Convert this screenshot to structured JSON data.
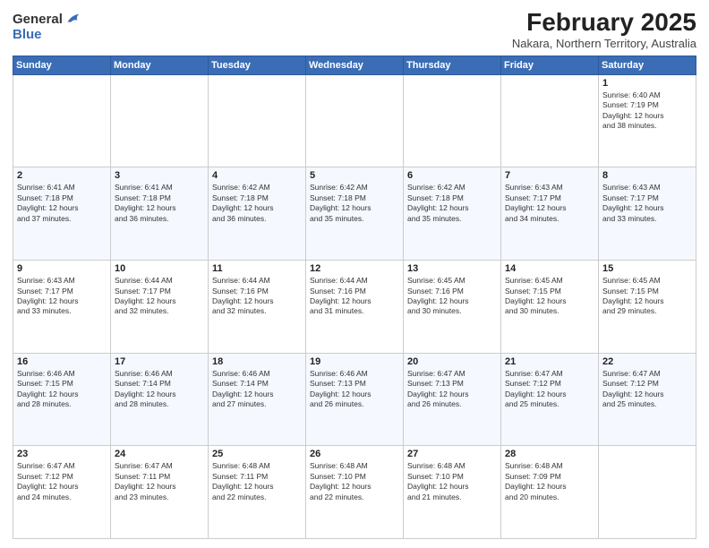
{
  "logo": {
    "general": "General",
    "blue": "Blue"
  },
  "title": "February 2025",
  "subtitle": "Nakara, Northern Territory, Australia",
  "days_of_week": [
    "Sunday",
    "Monday",
    "Tuesday",
    "Wednesday",
    "Thursday",
    "Friday",
    "Saturday"
  ],
  "weeks": [
    [
      {
        "day": "",
        "info": ""
      },
      {
        "day": "",
        "info": ""
      },
      {
        "day": "",
        "info": ""
      },
      {
        "day": "",
        "info": ""
      },
      {
        "day": "",
        "info": ""
      },
      {
        "day": "",
        "info": ""
      },
      {
        "day": "1",
        "info": "Sunrise: 6:40 AM\nSunset: 7:19 PM\nDaylight: 12 hours\nand 38 minutes."
      }
    ],
    [
      {
        "day": "2",
        "info": "Sunrise: 6:41 AM\nSunset: 7:18 PM\nDaylight: 12 hours\nand 37 minutes."
      },
      {
        "day": "3",
        "info": "Sunrise: 6:41 AM\nSunset: 7:18 PM\nDaylight: 12 hours\nand 36 minutes."
      },
      {
        "day": "4",
        "info": "Sunrise: 6:42 AM\nSunset: 7:18 PM\nDaylight: 12 hours\nand 36 minutes."
      },
      {
        "day": "5",
        "info": "Sunrise: 6:42 AM\nSunset: 7:18 PM\nDaylight: 12 hours\nand 35 minutes."
      },
      {
        "day": "6",
        "info": "Sunrise: 6:42 AM\nSunset: 7:18 PM\nDaylight: 12 hours\nand 35 minutes."
      },
      {
        "day": "7",
        "info": "Sunrise: 6:43 AM\nSunset: 7:17 PM\nDaylight: 12 hours\nand 34 minutes."
      },
      {
        "day": "8",
        "info": "Sunrise: 6:43 AM\nSunset: 7:17 PM\nDaylight: 12 hours\nand 33 minutes."
      }
    ],
    [
      {
        "day": "9",
        "info": "Sunrise: 6:43 AM\nSunset: 7:17 PM\nDaylight: 12 hours\nand 33 minutes."
      },
      {
        "day": "10",
        "info": "Sunrise: 6:44 AM\nSunset: 7:17 PM\nDaylight: 12 hours\nand 32 minutes."
      },
      {
        "day": "11",
        "info": "Sunrise: 6:44 AM\nSunset: 7:16 PM\nDaylight: 12 hours\nand 32 minutes."
      },
      {
        "day": "12",
        "info": "Sunrise: 6:44 AM\nSunset: 7:16 PM\nDaylight: 12 hours\nand 31 minutes."
      },
      {
        "day": "13",
        "info": "Sunrise: 6:45 AM\nSunset: 7:16 PM\nDaylight: 12 hours\nand 30 minutes."
      },
      {
        "day": "14",
        "info": "Sunrise: 6:45 AM\nSunset: 7:15 PM\nDaylight: 12 hours\nand 30 minutes."
      },
      {
        "day": "15",
        "info": "Sunrise: 6:45 AM\nSunset: 7:15 PM\nDaylight: 12 hours\nand 29 minutes."
      }
    ],
    [
      {
        "day": "16",
        "info": "Sunrise: 6:46 AM\nSunset: 7:15 PM\nDaylight: 12 hours\nand 28 minutes."
      },
      {
        "day": "17",
        "info": "Sunrise: 6:46 AM\nSunset: 7:14 PM\nDaylight: 12 hours\nand 28 minutes."
      },
      {
        "day": "18",
        "info": "Sunrise: 6:46 AM\nSunset: 7:14 PM\nDaylight: 12 hours\nand 27 minutes."
      },
      {
        "day": "19",
        "info": "Sunrise: 6:46 AM\nSunset: 7:13 PM\nDaylight: 12 hours\nand 26 minutes."
      },
      {
        "day": "20",
        "info": "Sunrise: 6:47 AM\nSunset: 7:13 PM\nDaylight: 12 hours\nand 26 minutes."
      },
      {
        "day": "21",
        "info": "Sunrise: 6:47 AM\nSunset: 7:12 PM\nDaylight: 12 hours\nand 25 minutes."
      },
      {
        "day": "22",
        "info": "Sunrise: 6:47 AM\nSunset: 7:12 PM\nDaylight: 12 hours\nand 25 minutes."
      }
    ],
    [
      {
        "day": "23",
        "info": "Sunrise: 6:47 AM\nSunset: 7:12 PM\nDaylight: 12 hours\nand 24 minutes."
      },
      {
        "day": "24",
        "info": "Sunrise: 6:47 AM\nSunset: 7:11 PM\nDaylight: 12 hours\nand 23 minutes."
      },
      {
        "day": "25",
        "info": "Sunrise: 6:48 AM\nSunset: 7:11 PM\nDaylight: 12 hours\nand 22 minutes."
      },
      {
        "day": "26",
        "info": "Sunrise: 6:48 AM\nSunset: 7:10 PM\nDaylight: 12 hours\nand 22 minutes."
      },
      {
        "day": "27",
        "info": "Sunrise: 6:48 AM\nSunset: 7:10 PM\nDaylight: 12 hours\nand 21 minutes."
      },
      {
        "day": "28",
        "info": "Sunrise: 6:48 AM\nSunset: 7:09 PM\nDaylight: 12 hours\nand 20 minutes."
      },
      {
        "day": "",
        "info": ""
      }
    ]
  ]
}
